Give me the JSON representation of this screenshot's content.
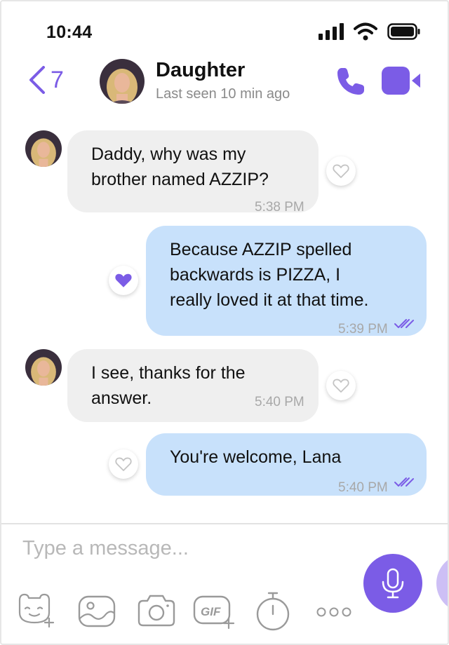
{
  "status_bar": {
    "time": "10:44"
  },
  "header": {
    "back_count": "7",
    "contact_name": "Daughter",
    "last_seen": "Last seen 10 min ago"
  },
  "colors": {
    "accent": "#7b5ce6",
    "incoming_bubble": "#efefef",
    "outgoing_bubble": "#c8e1fb"
  },
  "messages": [
    {
      "direction": "incoming",
      "text": "Daddy, why was my\nbrother named AZZIP?",
      "time": "5:38 PM",
      "liked": false
    },
    {
      "direction": "outgoing",
      "text": "Because AZZIP spelled\nbackwards is PIZZA, I\nreally loved it at that time.",
      "time": "5:39 PM",
      "liked": true,
      "read": true
    },
    {
      "direction": "incoming",
      "text": "I see, thanks for the\nanswer.",
      "time": "5:40 PM",
      "liked": false
    },
    {
      "direction": "outgoing",
      "text": "You're welcome, Lana",
      "time": "5:40 PM",
      "liked": false,
      "read": true
    }
  ],
  "composer": {
    "placeholder": "Type a message...",
    "tools": [
      "sticker-icon",
      "gallery-icon",
      "camera-icon",
      "gif-icon",
      "timer-icon",
      "more-icon"
    ]
  }
}
